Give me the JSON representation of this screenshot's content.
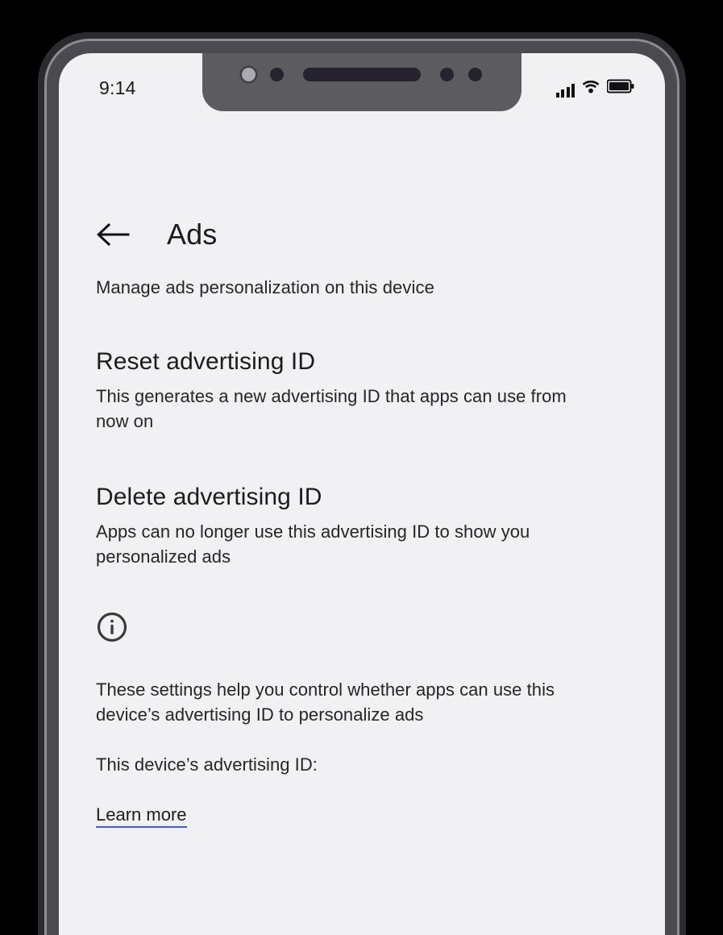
{
  "status_bar": {
    "time": "9:14",
    "signal_icon": "signal-bars-icon",
    "wifi_icon": "wifi-icon",
    "battery_icon": "battery-icon"
  },
  "app_bar": {
    "back_icon": "back-arrow-icon",
    "title": "Ads"
  },
  "subtitle": "Manage ads personalization on this device",
  "sections": [
    {
      "title": "Reset advertising ID",
      "description": "This generates a new advertising ID that apps can use from now on"
    },
    {
      "title": "Delete advertising ID",
      "description": "Apps can no longer use this advertising ID to show you personalized ads"
    }
  ],
  "info": {
    "icon": "info-circle-icon",
    "paragraph": "These settings help you control whether apps can use this device’s advertising ID to personalize ads",
    "device_id_label": "This device’s advertising ID:",
    "learn_more": "Learn more"
  },
  "colors": {
    "screen_background": "#f1f1f3",
    "text_primary": "#1c1c1e",
    "text_secondary": "#25252a",
    "link_underline": "#3d5afe",
    "frame_outer": "#2b2b30",
    "frame_inner": "#4a4a50",
    "notch": "#5b5b60"
  }
}
